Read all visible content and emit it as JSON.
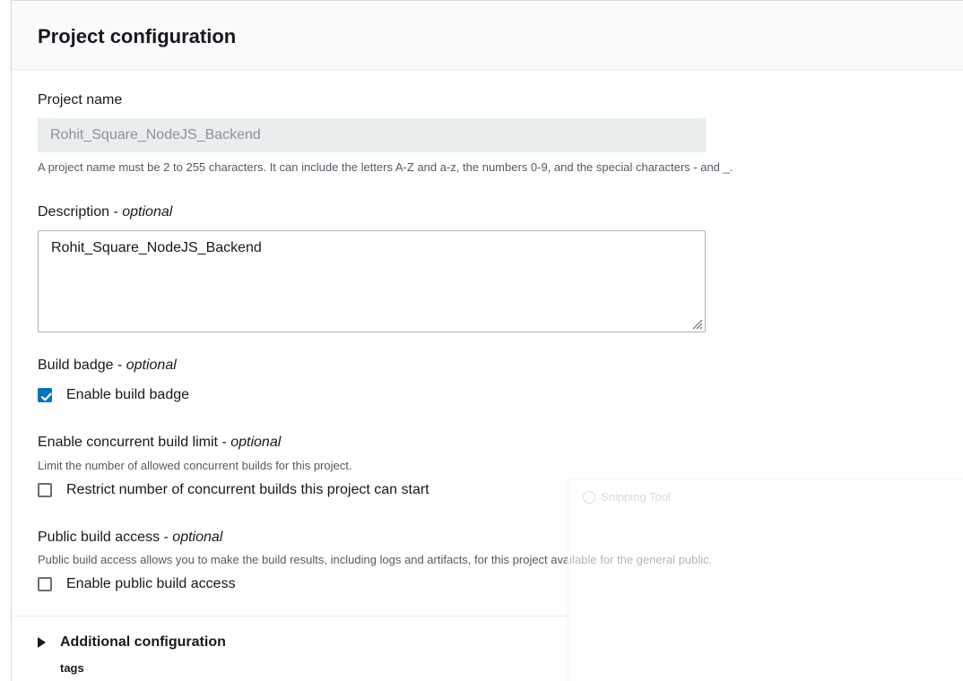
{
  "section": {
    "title": "Project configuration"
  },
  "project_name": {
    "label": "Project name",
    "value": "Rohit_Square_NodeJS_Backend",
    "hint": "A project name must be 2 to 255 characters. It can include the letters A-Z and a-z, the numbers 0-9, and the special characters - and _."
  },
  "description": {
    "label": "Description - ",
    "label_optional": "optional",
    "value": "Rohit_Square_NodeJS_Backend"
  },
  "build_badge": {
    "label": "Build badge - ",
    "label_optional": "optional",
    "checkbox_label": "Enable build badge",
    "checked": true
  },
  "concurrent_limit": {
    "label": "Enable concurrent build limit - ",
    "label_optional": "optional",
    "hint": "Limit the number of allowed concurrent builds for this project.",
    "checkbox_label": "Restrict number of concurrent builds this project can start",
    "checked": false
  },
  "public_access": {
    "label": "Public build access - ",
    "label_optional": "optional",
    "hint": "Public build access allows you to make the build results, including logs and artifacts, for this project available for the general public.",
    "checkbox_label": "Enable public build access",
    "checked": false
  },
  "additional": {
    "label": "Additional configuration",
    "sublabel": "tags"
  },
  "overlay": {
    "title": "Snipping Tool"
  },
  "colors": {
    "accent": "#0073bb",
    "disabled_bg": "#eaeded",
    "border": "#aab7b8"
  }
}
